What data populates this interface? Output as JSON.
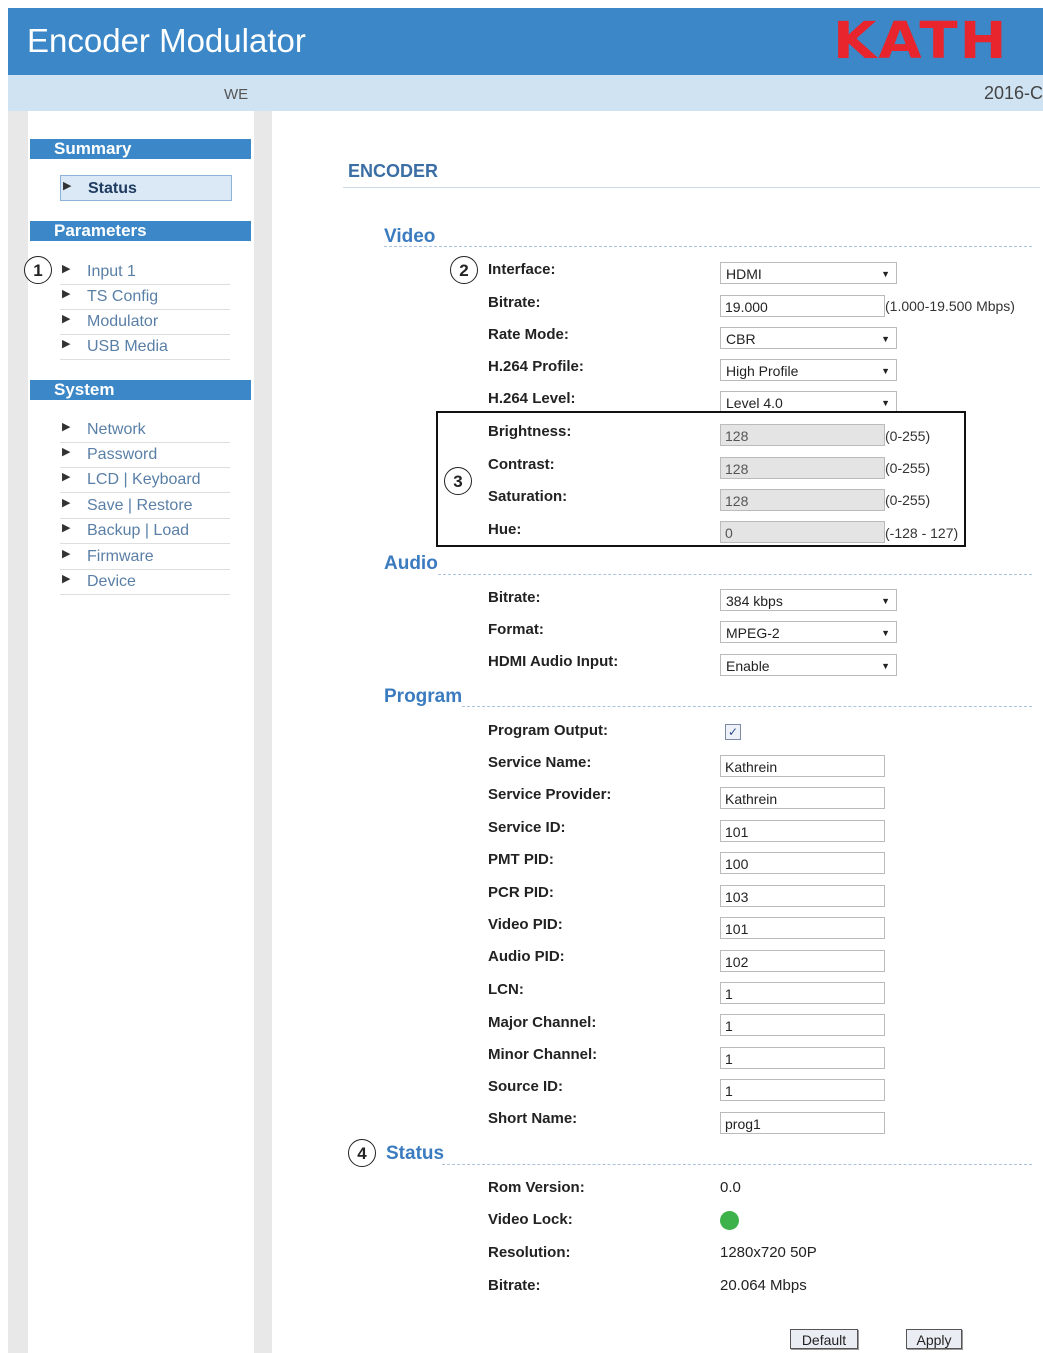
{
  "header": {
    "title": "Encoder Modulator",
    "logo_text": "KATH",
    "sub_left": "WE",
    "sub_right": "2016-C"
  },
  "sidebar": {
    "summary": {
      "title": "Summary",
      "items": [
        {
          "label": "Status",
          "active": true
        }
      ]
    },
    "parameters": {
      "title": "Parameters",
      "items": [
        {
          "label": "Input 1"
        },
        {
          "label": "TS Config"
        },
        {
          "label": "Modulator"
        },
        {
          "label": "USB Media"
        }
      ]
    },
    "system": {
      "title": "System",
      "items": [
        {
          "label": "Network"
        },
        {
          "label": "Password"
        },
        {
          "label": "LCD | Keyboard"
        },
        {
          "label": "Save | Restore"
        },
        {
          "label": "Backup | Load"
        },
        {
          "label": "Firmware"
        },
        {
          "label": "Device"
        }
      ]
    }
  },
  "callouts": [
    "1",
    "2",
    "3",
    "4"
  ],
  "main": {
    "title": "ENCODER",
    "video": {
      "title": "Video",
      "interface": {
        "label": "Interface:",
        "value": "HDMI"
      },
      "bitrate": {
        "label": "Bitrate:",
        "value": "19.000",
        "unit": "(1.000-19.500 Mbps)"
      },
      "rate_mode": {
        "label": "Rate Mode:",
        "value": "CBR"
      },
      "h264_profile": {
        "label": "H.264 Profile:",
        "value": "High Profile"
      },
      "h264_level": {
        "label": "H.264 Level:",
        "value": "Level 4.0"
      },
      "brightness": {
        "label": "Brightness:",
        "value": "128",
        "unit": "(0-255)"
      },
      "contrast": {
        "label": "Contrast:",
        "value": "128",
        "unit": "(0-255)"
      },
      "saturation": {
        "label": "Saturation:",
        "value": "128",
        "unit": "(0-255)"
      },
      "hue": {
        "label": "Hue:",
        "value": "0",
        "unit": "(-128 - 127)"
      }
    },
    "audio": {
      "title": "Audio",
      "bitrate": {
        "label": "Bitrate:",
        "value": "384 kbps"
      },
      "format": {
        "label": "Format:",
        "value": "MPEG-2"
      },
      "hdmi_audio_input": {
        "label": "HDMI Audio Input:",
        "value": "Enable"
      }
    },
    "program": {
      "title": "Program",
      "output": {
        "label": "Program Output:",
        "checked": true,
        "mark": "✓"
      },
      "fields": [
        {
          "label": "Service Name:",
          "value": "Kathrein"
        },
        {
          "label": "Service Provider:",
          "value": "Kathrein"
        },
        {
          "label": "Service ID:",
          "value": "101"
        },
        {
          "label": "PMT PID:",
          "value": "100"
        },
        {
          "label": "PCR PID:",
          "value": "103"
        },
        {
          "label": "Video PID:",
          "value": "101"
        },
        {
          "label": "Audio PID:",
          "value": "102"
        },
        {
          "label": "LCN:",
          "value": "1"
        },
        {
          "label": "Major Channel:",
          "value": "1"
        },
        {
          "label": "Minor Channel:",
          "value": "1"
        },
        {
          "label": "Source ID:",
          "value": "1"
        },
        {
          "label": "Short Name:",
          "value": "prog1"
        }
      ]
    },
    "status": {
      "title": "Status",
      "rom_version": {
        "label": "Rom Version:",
        "value": "0.0"
      },
      "video_lock": {
        "label": "Video Lock:",
        "locked": true,
        "color": "#3db24b"
      },
      "resolution": {
        "label": "Resolution:",
        "value": "1280x720 50P"
      },
      "bitrate": {
        "label": "Bitrate:",
        "value": "20.064 Mbps"
      }
    },
    "buttons": {
      "default": "Default",
      "apply": "Apply"
    }
  }
}
